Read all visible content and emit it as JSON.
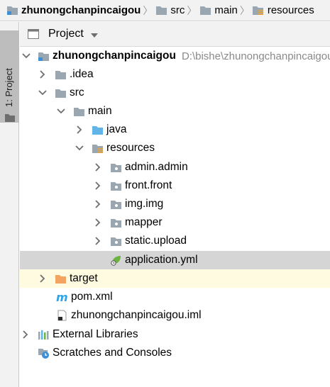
{
  "breadcrumb": {
    "items": [
      {
        "label": "zhunongchanpincaigou",
        "icon": "module-folder-icon",
        "bold": true
      },
      {
        "label": "src",
        "icon": "folder-icon",
        "bold": false
      },
      {
        "label": "main",
        "icon": "folder-icon",
        "bold": false
      },
      {
        "label": "resources",
        "icon": "resources-folder-icon",
        "bold": false
      }
    ]
  },
  "sidebar": {
    "tool_label": "1: Project",
    "icon": "project-folder-icon"
  },
  "project_panel": {
    "title": "Project",
    "dropdown_icon": "chevron-down-icon"
  },
  "tree": {
    "root": {
      "label": "zhunongchanpincaigou",
      "path": "D:\\bishe\\zhunongchanpincaigou"
    },
    "idea": {
      "label": ".idea"
    },
    "src": {
      "label": "src"
    },
    "main": {
      "label": "main"
    },
    "java": {
      "label": "java"
    },
    "resources": {
      "label": "resources"
    },
    "admin": {
      "label": "admin.admin"
    },
    "front": {
      "label": "front.front"
    },
    "img": {
      "label": "img.img"
    },
    "mapper": {
      "label": "mapper"
    },
    "static": {
      "label": "static.upload"
    },
    "application": {
      "label": "application.yml"
    },
    "target": {
      "label": "target"
    },
    "pom": {
      "label": "pom.xml"
    },
    "iml": {
      "label": "zhunongchanpincaigou.iml"
    },
    "external": {
      "label": "External Libraries"
    },
    "scratches": {
      "label": "Scratches and Consoles"
    }
  },
  "colors": {
    "folder": "#9aa7b0",
    "source_folder": "#62b3e8",
    "excluded_folder": "#f4a462",
    "selection": "#d5d5d5",
    "excluded_row": "#fffbe0",
    "maven": "#2fa4e7",
    "spring": "#6db33f"
  }
}
